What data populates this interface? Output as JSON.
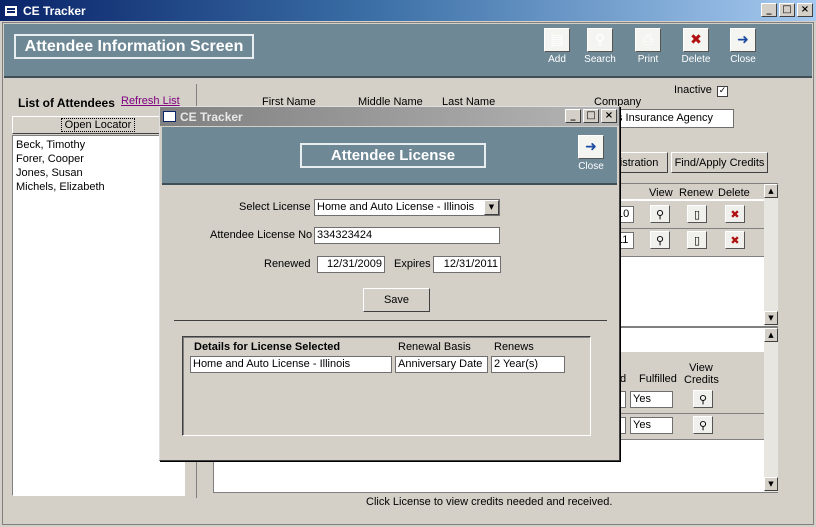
{
  "window": {
    "title": "CE Tracker",
    "minimize": "_",
    "maximize": "□",
    "close": "×"
  },
  "header": {
    "title": "Attendee Information Screen",
    "buttons": [
      {
        "label": "Add",
        "glyph": "▤"
      },
      {
        "label": "Search",
        "glyph": "⚲"
      },
      {
        "label": "Print",
        "glyph": "⎙"
      },
      {
        "label": "Delete",
        "glyph": "✖"
      },
      {
        "label": "Close",
        "glyph": "➜"
      }
    ]
  },
  "left": {
    "list_title": "List of Attendees",
    "refresh_link": "Refresh List",
    "open_locator": "Open Locator",
    "attendees": [
      "Beck, Timothy",
      "Forer, Cooper",
      "Jones, Susan",
      "Michels, Elizabeth"
    ]
  },
  "main": {
    "col_first": "First Name",
    "col_middle": "Middle Name",
    "col_last": "Last Name",
    "col_company": "Company",
    "company_value": "s Insurance Agency",
    "inactive_label": "Inactive",
    "inactive_checked": "✓",
    "registration_button": "gistration",
    "find_apply_button": "Find/Apply Credits",
    "license_cols": {
      "view": "View",
      "renew": "Renew",
      "delete": "Delete"
    },
    "license_rows": [
      {
        "date_tail": "10"
      },
      {
        "date_tail": "11"
      }
    ],
    "credit_cols": {
      "d": "d",
      "fulfilled": "Fulfilled",
      "view_credits_1": "View",
      "view_credits_2": "Credits"
    },
    "credit_rows": [
      {
        "fulfilled": "Yes"
      },
      {
        "fulfilled": "Yes"
      }
    ],
    "footer_text": "Click License to view credits needed and received."
  },
  "modal": {
    "title": "CE Tracker",
    "header_title": "Attendee License",
    "close_label": "Close",
    "select_license_label": "Select License",
    "select_license_value": "Home and Auto License - Illinois",
    "license_no_label": "Attendee License No",
    "license_no_value": "334323424",
    "renewed_label": "Renewed",
    "renewed_value": "12/31/2009",
    "expires_label": "Expires",
    "expires_value": "12/31/2011",
    "save_label": "Save",
    "details": {
      "title": "Details for License Selected",
      "renewal_basis_label": "Renewal Basis",
      "renews_label": "Renews",
      "license_value": "Home and Auto License - Illinois",
      "renewal_basis_value": "Anniversary Date",
      "renews_value": "2 Year(s)"
    }
  }
}
